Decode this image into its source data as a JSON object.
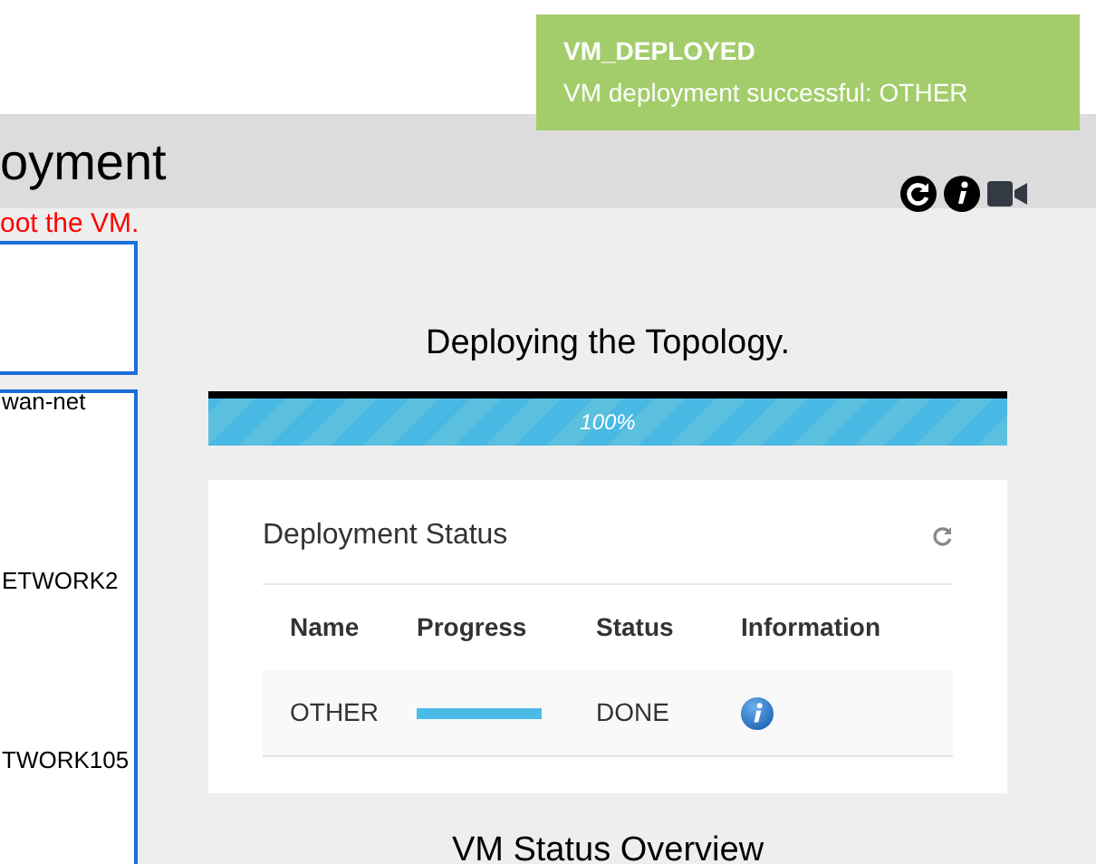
{
  "notification": {
    "title": "VM_DEPLOYED",
    "message": "VM deployment successful: OTHER"
  },
  "page": {
    "title": "oyment",
    "warning": "oot the VM."
  },
  "left_panel_items": [
    "wan-net",
    "ETWORK2",
    "TWORK105"
  ],
  "deploy": {
    "title": "Deploying the Topology.",
    "level": 1,
    "reading": "100%"
  },
  "status_card": {
    "title": "Deployment Status",
    "columns": [
      "Name",
      "Progress",
      "Status",
      "Information"
    ],
    "rows": [
      {
        "name": "OTHER",
        "level": 1,
        "status": "DONE"
      }
    ]
  },
  "vm_overview": {
    "title": "VM Status Overview"
  }
}
